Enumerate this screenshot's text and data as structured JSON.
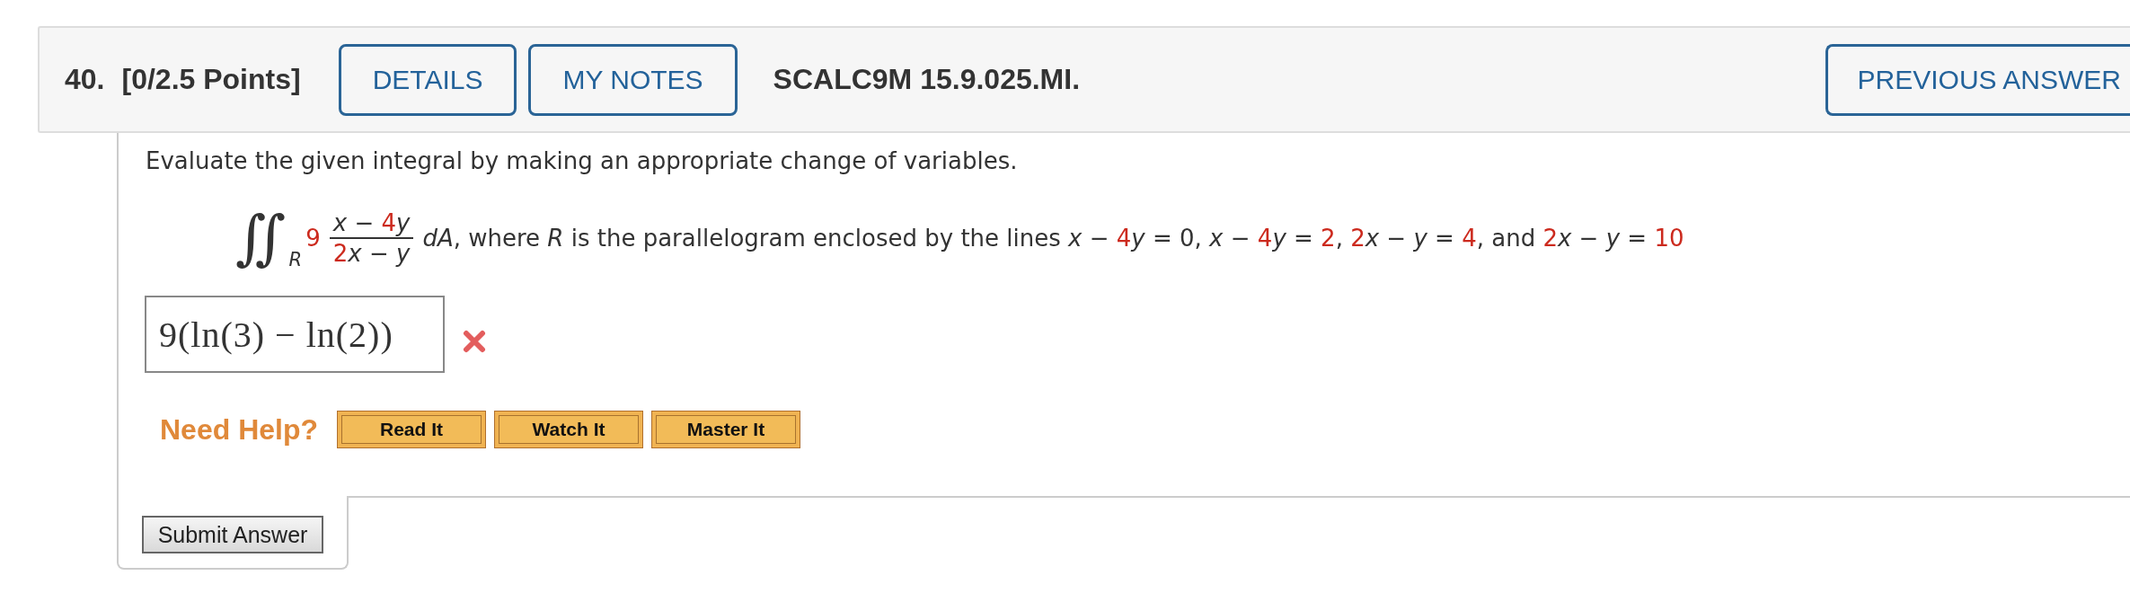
{
  "question": {
    "number": "40.",
    "points": "[0/2.5 Points]",
    "buttons": [
      {
        "label": "DETAILS"
      },
      {
        "label": "MY NOTES"
      }
    ],
    "code": "SCALC9M 15.9.025.MI.",
    "previous_answers_button": "PREVIOUS ANSWER"
  },
  "prompt": "Evaluate the given integral by making an appropriate change of variables.",
  "integral": {
    "symbol": "∬",
    "region": "R",
    "coefficient": {
      "text": "9",
      "highlighted": true
    },
    "numerator": [
      {
        "text": "*x* − ",
        "highlighted": false
      },
      {
        "text": "4",
        "highlighted": true
      },
      {
        "text": "*y*",
        "highlighted": false
      }
    ],
    "denominator": [
      {
        "text": "2",
        "highlighted": true
      },
      {
        "text": "*x* − *y*",
        "highlighted": false
      }
    ],
    "condition": [
      {
        "text": "*dA*, where *R* is the parallelogram enclosed by the lines *x* − ",
        "highlighted": false
      },
      {
        "text": "4",
        "highlighted": true
      },
      {
        "text": "*y* = 0, *x* − ",
        "highlighted": false
      },
      {
        "text": "4",
        "highlighted": true
      },
      {
        "text": "*y* = ",
        "highlighted": false
      },
      {
        "text": "2",
        "highlighted": true
      },
      {
        "text": ", ",
        "highlighted": false
      },
      {
        "text": "2",
        "highlighted": true
      },
      {
        "text": "*x* − *y* = ",
        "highlighted": false
      },
      {
        "text": "4",
        "highlighted": true
      },
      {
        "text": ", and ",
        "highlighted": false
      },
      {
        "text": "2",
        "highlighted": true
      },
      {
        "text": "*x* − *y* = ",
        "highlighted": false
      },
      {
        "text": "10",
        "highlighted": true
      }
    ]
  },
  "answer": {
    "value": "9(ln(3) − ln(2))",
    "correct": false
  },
  "help": {
    "label": "Need Help?",
    "buttons": [
      {
        "label": "Read It"
      },
      {
        "label": "Watch It"
      },
      {
        "label": "Master It"
      }
    ]
  },
  "submit_button": "Submit Answer"
}
